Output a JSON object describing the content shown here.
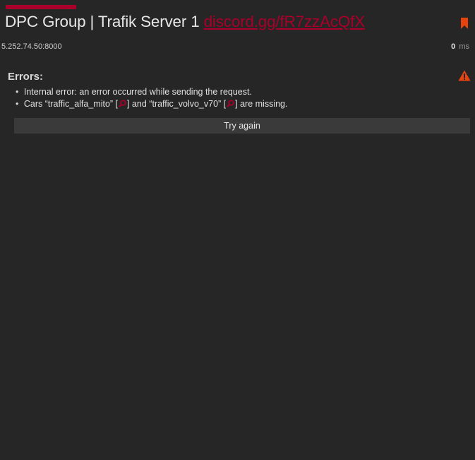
{
  "header": {
    "title": "DPC Group | Trafik Server 1",
    "link": "discord.gg/fR7zzAcQfX",
    "address": "5.252.74.50:8000",
    "ping_value": "0",
    "ping_unit": "ms",
    "bookmark_icon": "bookmark-icon",
    "accent_color": "#a8002a"
  },
  "errors": {
    "heading": "Errors:",
    "warning_icon": "warning-icon",
    "warning_color": "#e8430f",
    "items": [
      {
        "text": "Internal error: an error occurred while sending the request."
      },
      {
        "prefix": "Cars “traffic_alfa_mito” [",
        "middle": "] and “traffic_volvo_v70” [",
        "suffix": "] are missing.",
        "icon": "search-car-icon"
      }
    ]
  },
  "actions": {
    "retry_label": "Try again"
  }
}
